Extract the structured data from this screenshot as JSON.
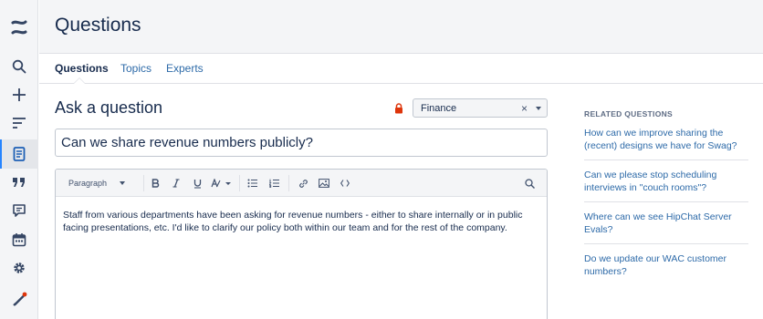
{
  "rail": {
    "items": [
      {
        "icon": "logo-icon"
      },
      {
        "icon": "search-icon"
      },
      {
        "icon": "plus-icon"
      },
      {
        "icon": "activity-icon"
      },
      {
        "icon": "page-icon",
        "active": true
      },
      {
        "icon": "quote-icon"
      },
      {
        "icon": "comment-icon"
      },
      {
        "icon": "calendar-icon"
      },
      {
        "icon": "gear-icon"
      },
      {
        "icon": "rocket-icon"
      }
    ]
  },
  "header": {
    "title": "Questions"
  },
  "tabs": [
    {
      "label": "Questions",
      "active": true
    },
    {
      "label": "Topics"
    },
    {
      "label": "Experts"
    }
  ],
  "ask": {
    "title": "Ask a question",
    "space_value": "Finance",
    "clear_glyph": "×",
    "question_value": "Can we share revenue numbers publicly?"
  },
  "editor": {
    "paragraph_label": "Paragraph",
    "body": "Staff from various departments have been asking for revenue numbers - either to share internally or in public facing presentations, etc. I'd like to clarify our policy both within our team and for the rest of the company."
  },
  "related": {
    "title": "RELATED QUESTIONS",
    "items": [
      "How can we improve sharing the (recent) designs we have for Swag?",
      "Can we please stop scheduling interviews in \"couch rooms\"?",
      "Where can we see HipChat Server Evals?",
      "Do we update our WAC customer numbers?"
    ]
  },
  "colors": {
    "accent": "#2684ff",
    "link": "#2d6aa8",
    "lock": "#de350b"
  }
}
